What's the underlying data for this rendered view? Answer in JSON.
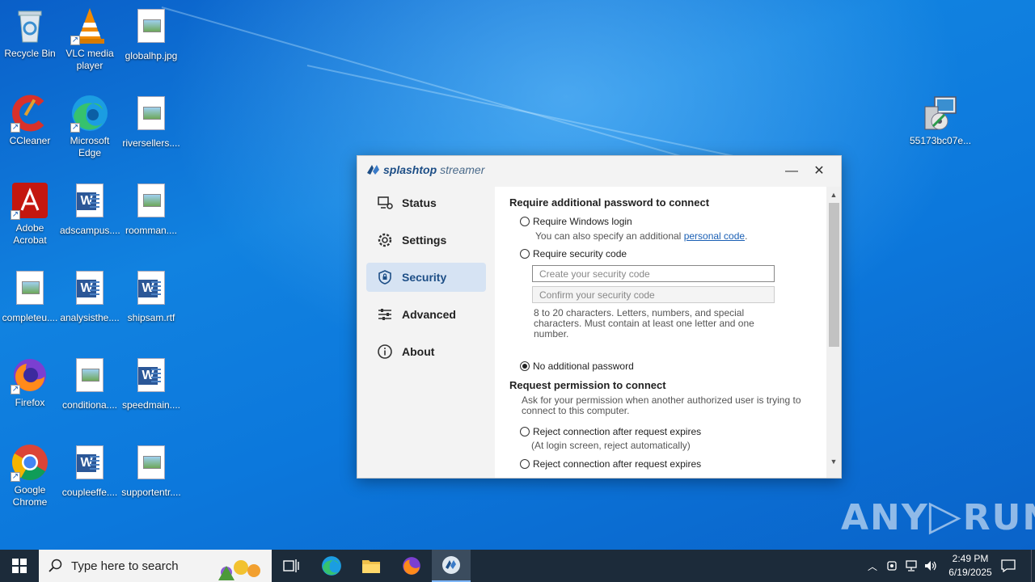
{
  "desktop": {
    "icons": [
      {
        "label": "Recycle Bin"
      },
      {
        "label": "VLC media player"
      },
      {
        "label": "globalhp.jpg"
      },
      {
        "label": "CCleaner"
      },
      {
        "label": "Microsoft Edge"
      },
      {
        "label": "riversellers...."
      },
      {
        "label": "Adobe Acrobat"
      },
      {
        "label": "adscampus...."
      },
      {
        "label": "roomman...."
      },
      {
        "label": "completeu...."
      },
      {
        "label": "analysisthe...."
      },
      {
        "label": "shipsam.rtf"
      },
      {
        "label": "Firefox"
      },
      {
        "label": "conditiona...."
      },
      {
        "label": "speedmain...."
      },
      {
        "label": "Google Chrome"
      },
      {
        "label": "coupleeffe...."
      },
      {
        "label": "supportentr...."
      },
      {
        "label": "55173bc07e..."
      }
    ],
    "watermark": "ANY RUN"
  },
  "window": {
    "logo_brand": "splashtop",
    "logo_product": "streamer",
    "minimize": "—",
    "close": "✕",
    "nav": [
      {
        "label": "Status"
      },
      {
        "label": "Settings"
      },
      {
        "label": "Security"
      },
      {
        "label": "Advanced"
      },
      {
        "label": "About"
      }
    ],
    "content": {
      "heading_password": "Require additional password to connect",
      "opt_windows_login": "Require Windows login",
      "note_personal_prefix": "You can also specify an additional ",
      "note_personal_link": "personal code",
      "note_personal_suffix": ".",
      "opt_security_code": "Require security code",
      "field_create_placeholder": "Create your security code",
      "field_confirm_placeholder": "Confirm your security code",
      "code_rules": "8 to 20 characters. Letters, numbers, and special characters. Must contain at least one letter and one number.",
      "opt_no_password": "No additional password",
      "heading_permission": "Request permission to connect",
      "permission_note": "Ask for your permission when another authorized user is trying to connect to this computer.",
      "opt_reject_1": "Reject connection after request expires",
      "reject_1_note": "(At login screen, reject automatically)",
      "opt_reject_2": "Reject connection after request expires"
    }
  },
  "taskbar": {
    "search_placeholder": "Type here to search",
    "time": "2:49 PM",
    "date": "6/19/2025"
  }
}
